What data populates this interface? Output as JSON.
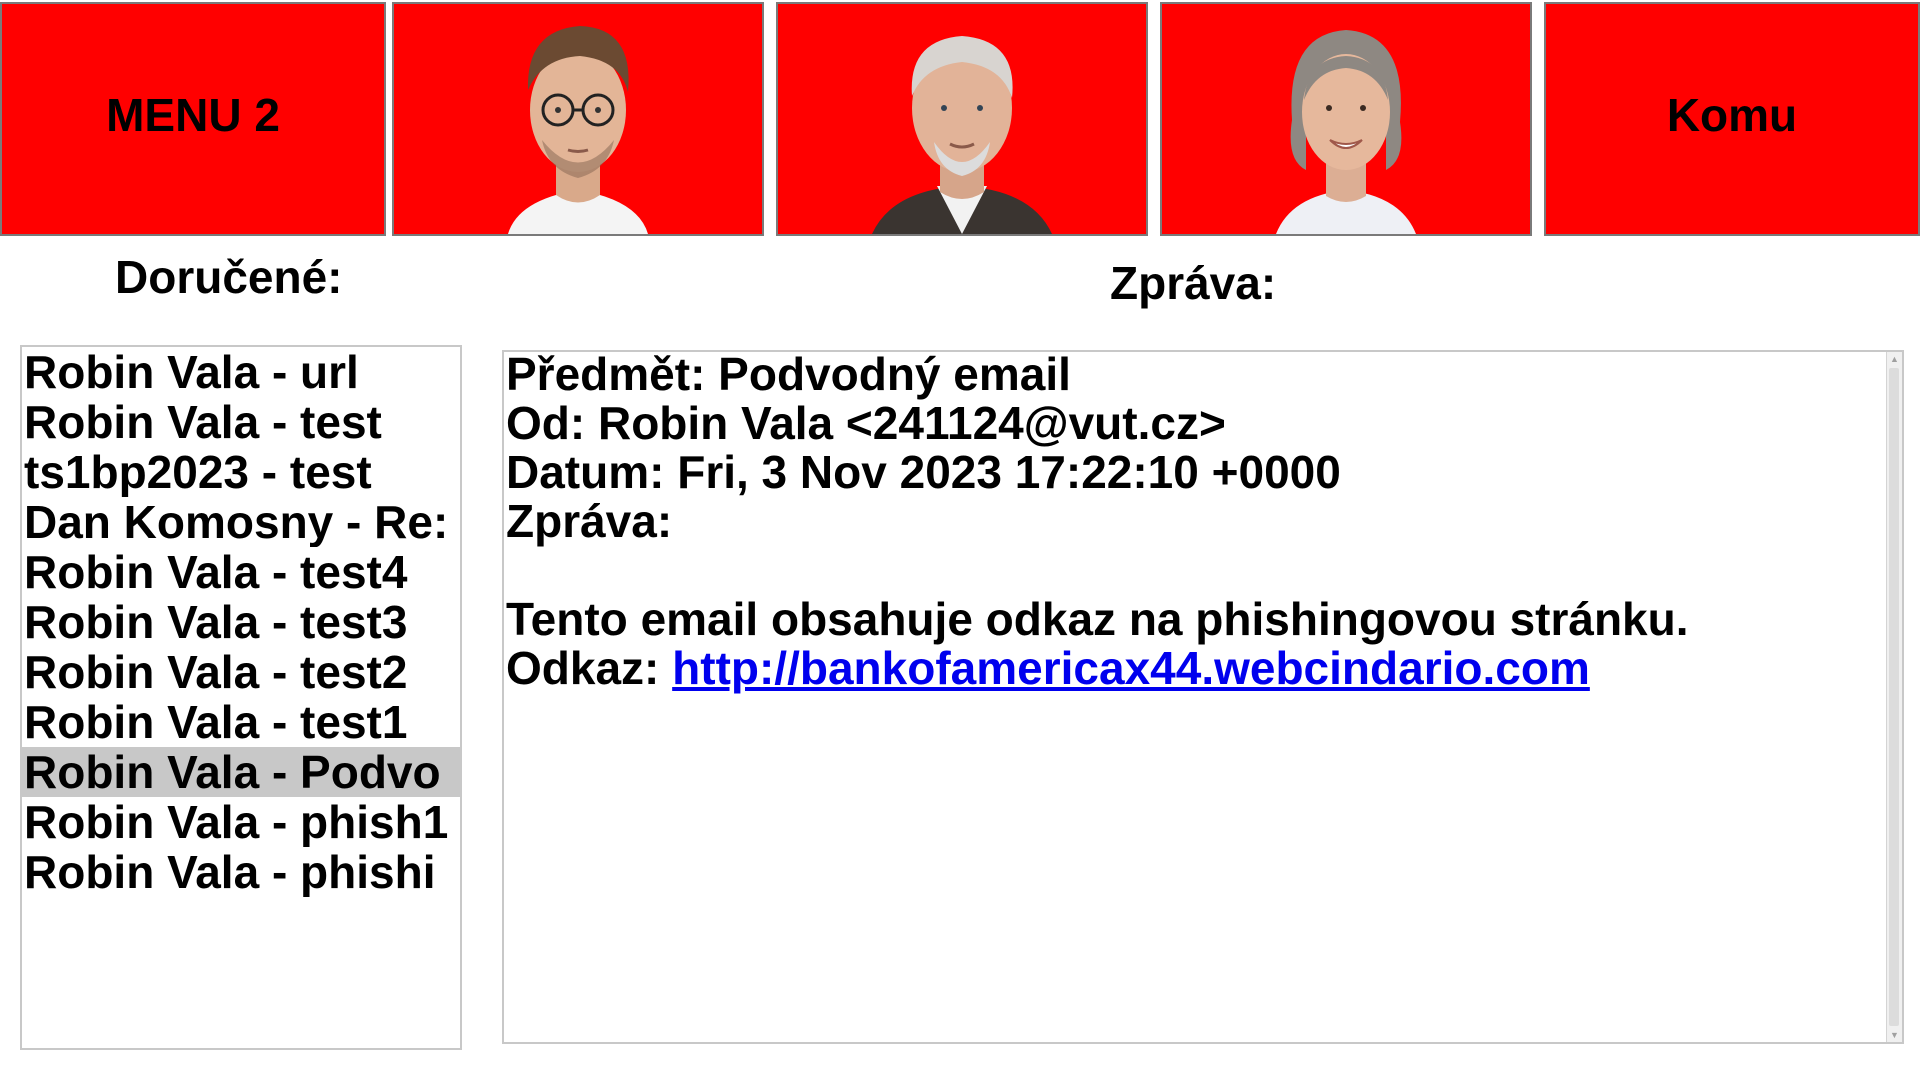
{
  "topbar": {
    "menu_label": "MENU 2",
    "contacts": [
      {
        "icon": "young-man-glasses-portrait"
      },
      {
        "icon": "older-man-portrait"
      },
      {
        "icon": "older-woman-portrait"
      }
    ],
    "to_label": "Komu"
  },
  "colors": {
    "tile_background": "#ff0000",
    "selection": "#c8c8c8",
    "link": "#0000ee"
  },
  "inbox": {
    "heading": "Doručené:",
    "items": [
      {
        "label": "Robin Vala - url"
      },
      {
        "label": "Robin Vala - test"
      },
      {
        "label": "ts1bp2023 - test"
      },
      {
        "label": "Dan Komosny - Re: "
      },
      {
        "label": "Robin Vala - test4"
      },
      {
        "label": "Robin Vala - test3"
      },
      {
        "label": "Robin Vala - test2"
      },
      {
        "label": "Robin Vala - test1"
      },
      {
        "label": "Robin Vala - Podvo",
        "selected": true
      },
      {
        "label": "Robin Vala - phish1"
      },
      {
        "label": "Robin Vala - phishi"
      }
    ]
  },
  "message": {
    "heading": "Zpráva:",
    "subject_line": "Předmět: Podvodný email",
    "from_line": "Od: Robin Vala <241124@vut.cz>",
    "date_line": "Datum: Fri, 3 Nov 2023 17:22:10 +0000",
    "body_label": "Zpráva:",
    "body_text": "Tento email obsahuje odkaz na phishingovou stránku.",
    "link_label": "Odkaz: ",
    "link_url": "http://bankofamericax44.webcindario.com"
  }
}
